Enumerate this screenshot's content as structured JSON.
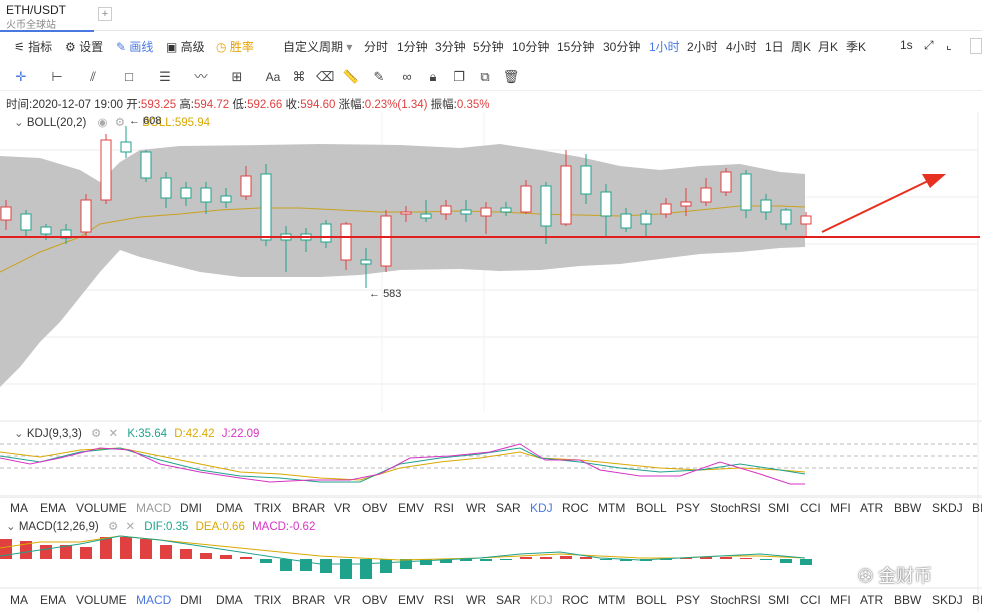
{
  "tab": {
    "title": "ETH/USDT",
    "subtitle": "火币全球站",
    "add": "+"
  },
  "toolbar": {
    "left": [
      {
        "key": "indicator",
        "icon": "sliders-icon",
        "label": "指标"
      },
      {
        "key": "settings",
        "icon": "gear-icon",
        "label": "设置"
      },
      {
        "key": "draw",
        "icon": "pencil-icon",
        "label": "画线"
      },
      {
        "key": "advanced",
        "icon": "briefcase-icon",
        "label": "高级"
      },
      {
        "key": "winrate",
        "icon": "clock-icon",
        "label": "胜率"
      }
    ],
    "custom_period": "自定义周期",
    "periods": [
      "分时",
      "1分钟",
      "3分钟",
      "5分钟",
      "10分钟",
      "15分钟",
      "30分钟",
      "1小时",
      "2小时",
      "4小时",
      "1日",
      "周K",
      "月K",
      "季K"
    ],
    "active_period": "1小时",
    "right_label": "1s"
  },
  "info": {
    "time_label": "时间:",
    "time": "2020-12-07 19:00",
    "open_label": "开:",
    "open": "593.25",
    "high_label": "高:",
    "high": "594.72",
    "low_label": "低:",
    "low": "592.66",
    "close_label": "收:",
    "close": "594.60",
    "change_label": "涨幅:",
    "change": "0.23%(1.34)",
    "amp_label": "振幅:",
    "amp": "0.35%"
  },
  "boll": {
    "label": "BOLL(20,2)",
    "value_label": "BOLL:",
    "value": "595.94",
    "max_label": "608",
    "min_label": "583"
  },
  "kdj": {
    "label": "KDJ(9,3,3)",
    "k_label": "K:",
    "k": "35.64",
    "d_label": "D:",
    "d": "42.42",
    "j_label": "J:",
    "j": "22.09"
  },
  "macd": {
    "label": "MACD(12,26,9)",
    "dif_label": "DIF:",
    "dif": "0.35",
    "dea_label": "DEA:",
    "dea": "0.66",
    "macd_label": "MACD:",
    "macd": "-0.62"
  },
  "indicator_tabs": [
    "MA",
    "EMA",
    "VOLUME",
    "MACD",
    "DMI",
    "DMA",
    "TRIX",
    "BRAR",
    "VR",
    "OBV",
    "EMV",
    "RSI",
    "WR",
    "SAR",
    "KDJ",
    "ROC",
    "MTM",
    "BOLL",
    "PSY",
    "StochRSI",
    "SMI",
    "CCI",
    "MFI",
    "ATR",
    "BBW",
    "SKDJ",
    "BIAS"
  ],
  "indicator_tabs_row1_active": "KDJ",
  "indicator_tabs_row2_active": "MACD",
  "watermark": "金财币",
  "colors": {
    "up": "#e04040",
    "down": "#1fa28c",
    "accent": "#4a78e2",
    "band": "#c4c4c4",
    "line_red": "#e02020",
    "yellow": "#d9a800",
    "magenta": "#d633c4"
  }
}
